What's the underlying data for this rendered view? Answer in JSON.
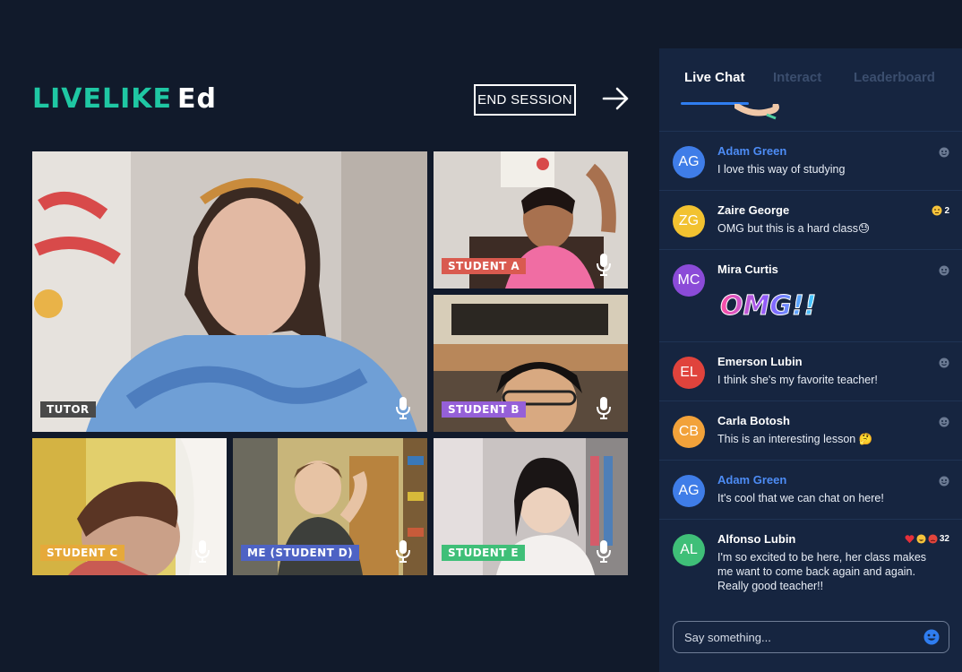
{
  "app": {
    "logo_brand": "LIVELIKE",
    "logo_suffix": "Ed",
    "end_session_label": "END SESSION"
  },
  "tiles": [
    {
      "label": "TUTOR",
      "label_color": "#4a4a4a"
    },
    {
      "label": "STUDENT A",
      "label_color": "#d95a4f"
    },
    {
      "label": "STUDENT B",
      "label_color": "#9560d8"
    },
    {
      "label": "STUDENT C",
      "label_color": "#e6a93a"
    },
    {
      "label": "ME (STUDENT D)",
      "label_color": "#4e63c4"
    },
    {
      "label": "STUDENT E",
      "label_color": "#3fbf78"
    }
  ],
  "tabs": [
    {
      "label": "Live Chat",
      "active": true
    },
    {
      "label": "Interact",
      "active": false
    },
    {
      "label": "Leaderboard",
      "active": false
    }
  ],
  "chat": {
    "messages": [
      {
        "initials": "AG",
        "name": "Adam Green",
        "text": "I love this way of studying",
        "avatar_color": "#3f7de8",
        "name_color": "blue"
      },
      {
        "initials": "ZG",
        "name": "Zaire George",
        "text": "OMG but this is a hard class😓",
        "avatar_color": "#f2c230",
        "reaction_count": "2"
      },
      {
        "initials": "MC",
        "name": "Mira Curtis",
        "sticker": "OMG!!",
        "avatar_color": "#8b4bd8"
      },
      {
        "initials": "EL",
        "name": "Emerson Lubin",
        "text": "I think she's my favorite teacher!",
        "avatar_color": "#e0433c"
      },
      {
        "initials": "CB",
        "name": "Carla Botosh",
        "text": "This is an interesting lesson 🤔",
        "avatar_color": "#f2a23a"
      },
      {
        "initials": "AG",
        "name": "Adam Green",
        "text": "It's cool that we can chat on here!",
        "avatar_color": "#3f7de8",
        "name_color": "blue"
      },
      {
        "initials": "AL",
        "name": "Alfonso Lubin",
        "text": "I'm so excited to be here, her class makes me want to come back again and again. Really good teacher!!",
        "avatar_color": "#3fbf78",
        "reaction_count": "32"
      }
    ],
    "input_placeholder": "Say something..."
  },
  "colors": {
    "background": "#111a2b",
    "panel": "#162540",
    "brand": "#1fc7a3",
    "accent": "#2f7df0"
  },
  "icons": [
    "exit-arrow-icon",
    "microphone-icon",
    "reaction-smiley-icon",
    "emoji-icon"
  ]
}
